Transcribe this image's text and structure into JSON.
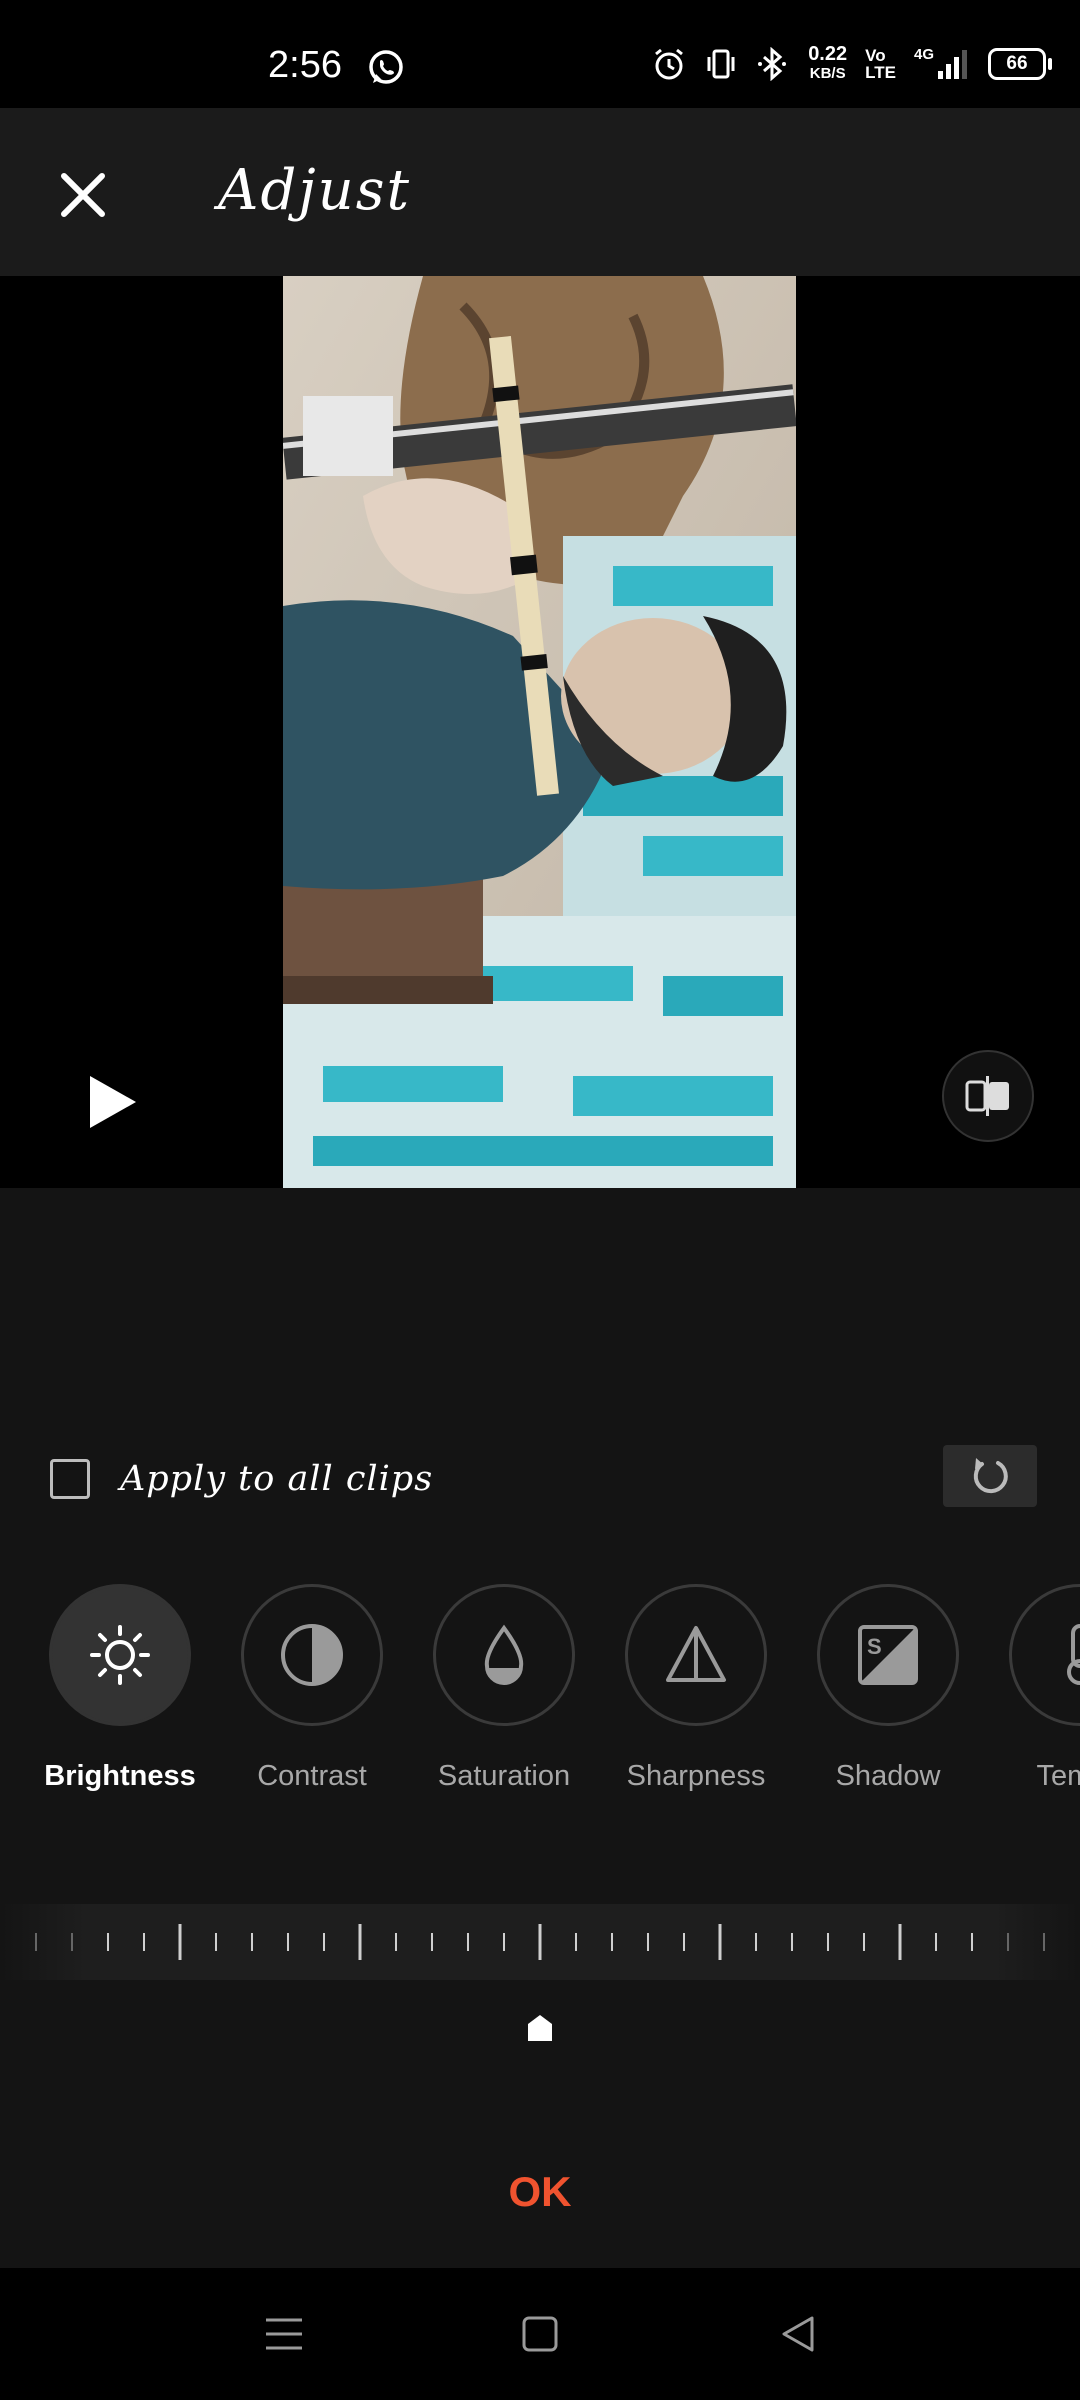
{
  "status_bar": {
    "time": "2:56",
    "net_speed_value": "0.22",
    "net_speed_unit": "KB/S",
    "volte_top": "Vo",
    "volte_bottom": "LTE",
    "network_label": "4G",
    "battery": "66"
  },
  "header": {
    "title": "Adjust"
  },
  "apply_all": {
    "label": "Apply to all clips",
    "checked": false
  },
  "tools": [
    {
      "label": "Brightness",
      "icon": "sun-icon",
      "active": true
    },
    {
      "label": "Contrast",
      "icon": "contrast-icon",
      "active": false
    },
    {
      "label": "Saturation",
      "icon": "droplet-icon",
      "active": false
    },
    {
      "label": "Sharpness",
      "icon": "triangle-icon",
      "active": false
    },
    {
      "label": "Shadow",
      "icon": "shadow-icon",
      "active": false
    },
    {
      "label": "Tempe",
      "icon": "thermometer-icon",
      "active": false
    }
  ],
  "slider": {
    "value": 0,
    "min": -100,
    "max": 100
  },
  "ok_label": "OK",
  "colors": {
    "accent": "#f0532f",
    "background": "#141414",
    "header": "#1b1b1b"
  }
}
